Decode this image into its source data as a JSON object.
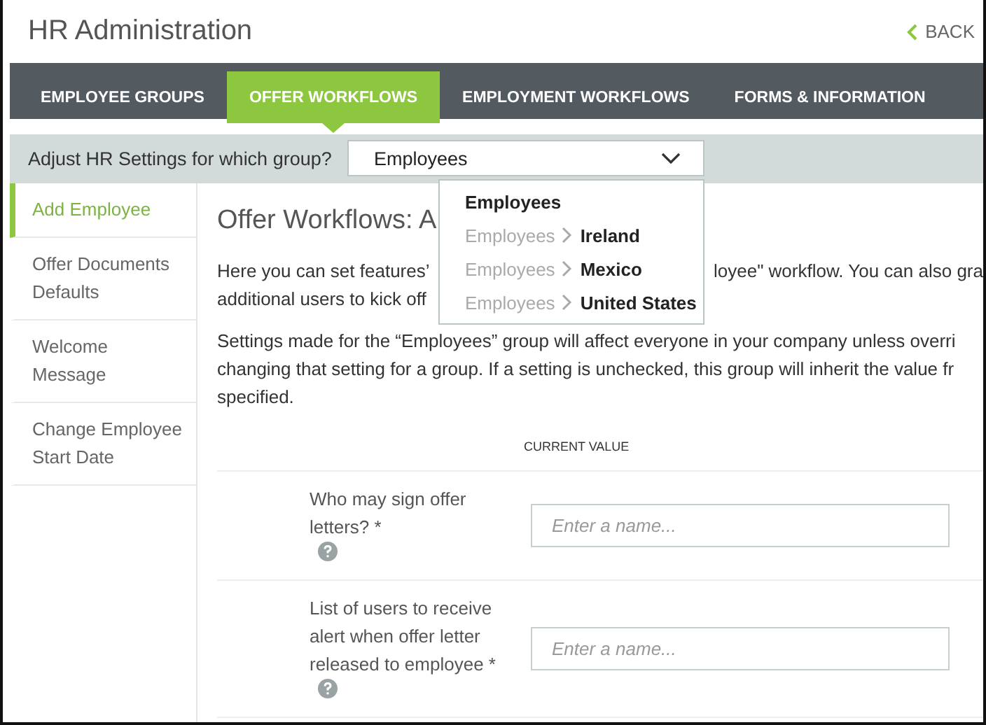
{
  "header": {
    "title": "HR Administration",
    "back_link": "BACK"
  },
  "tabs": [
    {
      "label": "EMPLOYEE GROUPS",
      "selected": false
    },
    {
      "label": "OFFER WORKFLOWS",
      "selected": true
    },
    {
      "label": "EMPLOYMENT WORKFLOWS",
      "selected": false
    },
    {
      "label": "FORMS & INFORMATION",
      "selected": false
    }
  ],
  "group_bar": {
    "label": "Adjust HR Settings for which group?",
    "value": "Employees",
    "options": [
      {
        "name": "Employees"
      },
      {
        "parent": "Employees",
        "name": "Ireland"
      },
      {
        "parent": "Employees",
        "name": "Mexico"
      },
      {
        "parent": "Employees",
        "name": "United States"
      }
    ]
  },
  "sidebar": {
    "items": [
      {
        "label": "Add Employee",
        "selected": true
      },
      {
        "label": "Offer Documents Defaults",
        "selected": false
      },
      {
        "label": "Welcome Message",
        "selected": false
      },
      {
        "label": "Change Employee Start Date",
        "selected": false
      }
    ]
  },
  "content": {
    "heading": "Offer Workflows: A",
    "intro_lines": [
      {
        "left": "Here you can set features’",
        "right": "loyee\" workflow. You can also gra"
      },
      {
        "left": "additional users to kick off"
      }
    ],
    "note_lines": [
      "Settings made for the “Employees” group will affect everyone in your company unless overri",
      "changing that setting for a group. If a setting is unchecked, this group will inherit the value fr",
      "specified."
    ],
    "column_header": "CURRENT VALUE",
    "settings": [
      {
        "label": "Who may sign offer letters? *",
        "placeholder": "Enter a name..."
      },
      {
        "label": "List of users to receive alert when offer letter released to employee *",
        "placeholder": "Enter a name..."
      }
    ]
  }
}
